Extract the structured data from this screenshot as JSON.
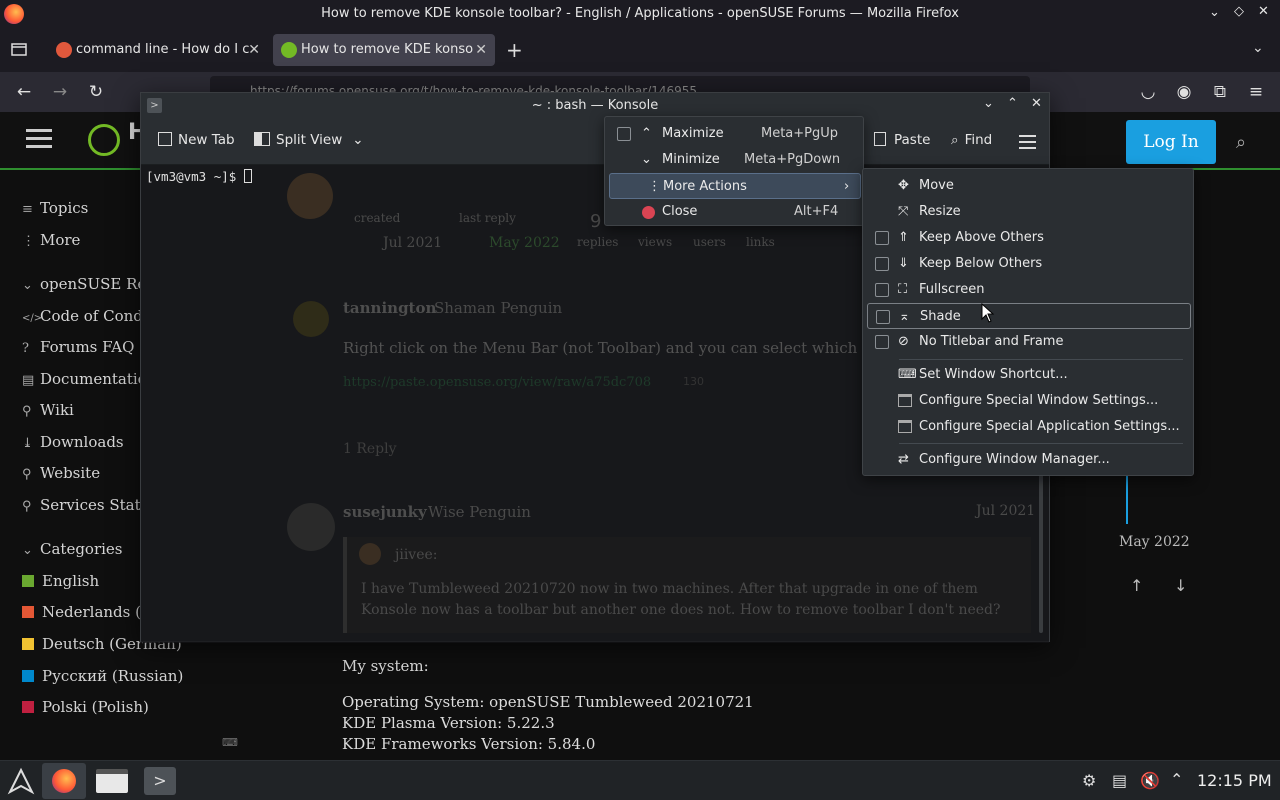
{
  "firefox": {
    "window_title": "How to remove KDE konsole toolbar? - English / Applications - openSUSE Forums — Mozilla Firefox",
    "tabs": [
      {
        "label": "command line - How do I c",
        "close": "✕"
      },
      {
        "label": "How to remove KDE konso",
        "close": "✕"
      }
    ],
    "new_tab": "+",
    "url": "https://forums.opensuse.org/t/how-to-remove-kde-konsole-toolbar/146955"
  },
  "forum": {
    "site_letter": "H",
    "login_label": "Log In",
    "sidebar": {
      "top": [
        {
          "icon": "≡",
          "label": "Topics"
        },
        {
          "icon": "⋮",
          "label": "More"
        }
      ],
      "resources_header": "openSUSE Resources",
      "resources": [
        {
          "icon": "</>",
          "label": "Code of Conduct"
        },
        {
          "icon": "?",
          "label": "Forums FAQ"
        },
        {
          "icon": "▤",
          "label": "Documentation"
        },
        {
          "icon": "⚲",
          "label": "Wiki"
        },
        {
          "icon": "⤓",
          "label": "Downloads"
        },
        {
          "icon": "⚲",
          "label": "Website"
        },
        {
          "icon": "⚲",
          "label": "Services Status Page"
        }
      ],
      "categories_header": "Categories",
      "categories": [
        {
          "label": "English",
          "color": "#6aa830"
        },
        {
          "label": "Nederlands (Dutch)",
          "color": "#e45735"
        },
        {
          "label": "Deutsch (German)",
          "color": "#f1c232"
        },
        {
          "label": "Русский (Russian)",
          "color": "#0088cc"
        },
        {
          "label": "Polski (Polish)",
          "color": "#c02040"
        }
      ]
    },
    "topic_meta": {
      "created": "created",
      "created_date": "Jul 2021",
      "last_reply": "last reply",
      "last_reply_date": "May 2022",
      "replies_n": "9",
      "replies": "replies",
      "views": "views",
      "users": "users",
      "links": "links"
    },
    "post1": {
      "user": "tannington",
      "title": "Shaman Penguin",
      "text": "Right click on the Menu Bar (not Toolbar) and you can select which toolb",
      "link": "https://paste.opensuse.org/view/raw/a75dc708",
      "link_count": "130",
      "reply_count": "1 Reply"
    },
    "post2": {
      "user": "susejunky",
      "title": "Wise Penguin",
      "date": "Jul 2021",
      "quote_user": "jiivee:",
      "quote_line1": "I have Tumbleweed 20210720 now in two machines. After that upgrade in one of them",
      "quote_line2": "Konsole now has a toolbar but another one does not. How to remove toolbar I don't need?",
      "body": [
        "My system:",
        "Operating System: openSUSE Tumbleweed 20210721",
        "KDE Plasma Version: 5.22.3",
        "KDE Frameworks Version: 5.84.0"
      ]
    },
    "timeline_date": "May 2022"
  },
  "konsole": {
    "title": "~ : bash — Konsole",
    "toolbar": {
      "new_tab": "New Tab",
      "split_view": "Split View",
      "paste": "Paste",
      "find": "Find"
    },
    "prompt": "[vm3@vm3 ~]$ "
  },
  "window_menu": {
    "items": [
      {
        "label": "Maximize",
        "shortcut": "Meta+PgUp"
      },
      {
        "label": "Minimize",
        "shortcut": "Meta+PgDown"
      },
      {
        "label": "More Actions",
        "shortcut": ""
      },
      {
        "label": "Close",
        "shortcut": "Alt+F4"
      }
    ]
  },
  "more_actions_menu": {
    "items": [
      {
        "label": "Move"
      },
      {
        "label": "Resize"
      },
      {
        "label": "Keep Above Others"
      },
      {
        "label": "Keep Below Others"
      },
      {
        "label": "Fullscreen"
      },
      {
        "label": "Shade"
      },
      {
        "label": "No Titlebar and Frame"
      },
      {
        "label": "Set Window Shortcut..."
      },
      {
        "label": "Configure Special Window Settings..."
      },
      {
        "label": "Configure Special Application Settings..."
      },
      {
        "label": "Configure Window Manager..."
      }
    ]
  },
  "taskbar": {
    "clock": "12:15 PM"
  }
}
